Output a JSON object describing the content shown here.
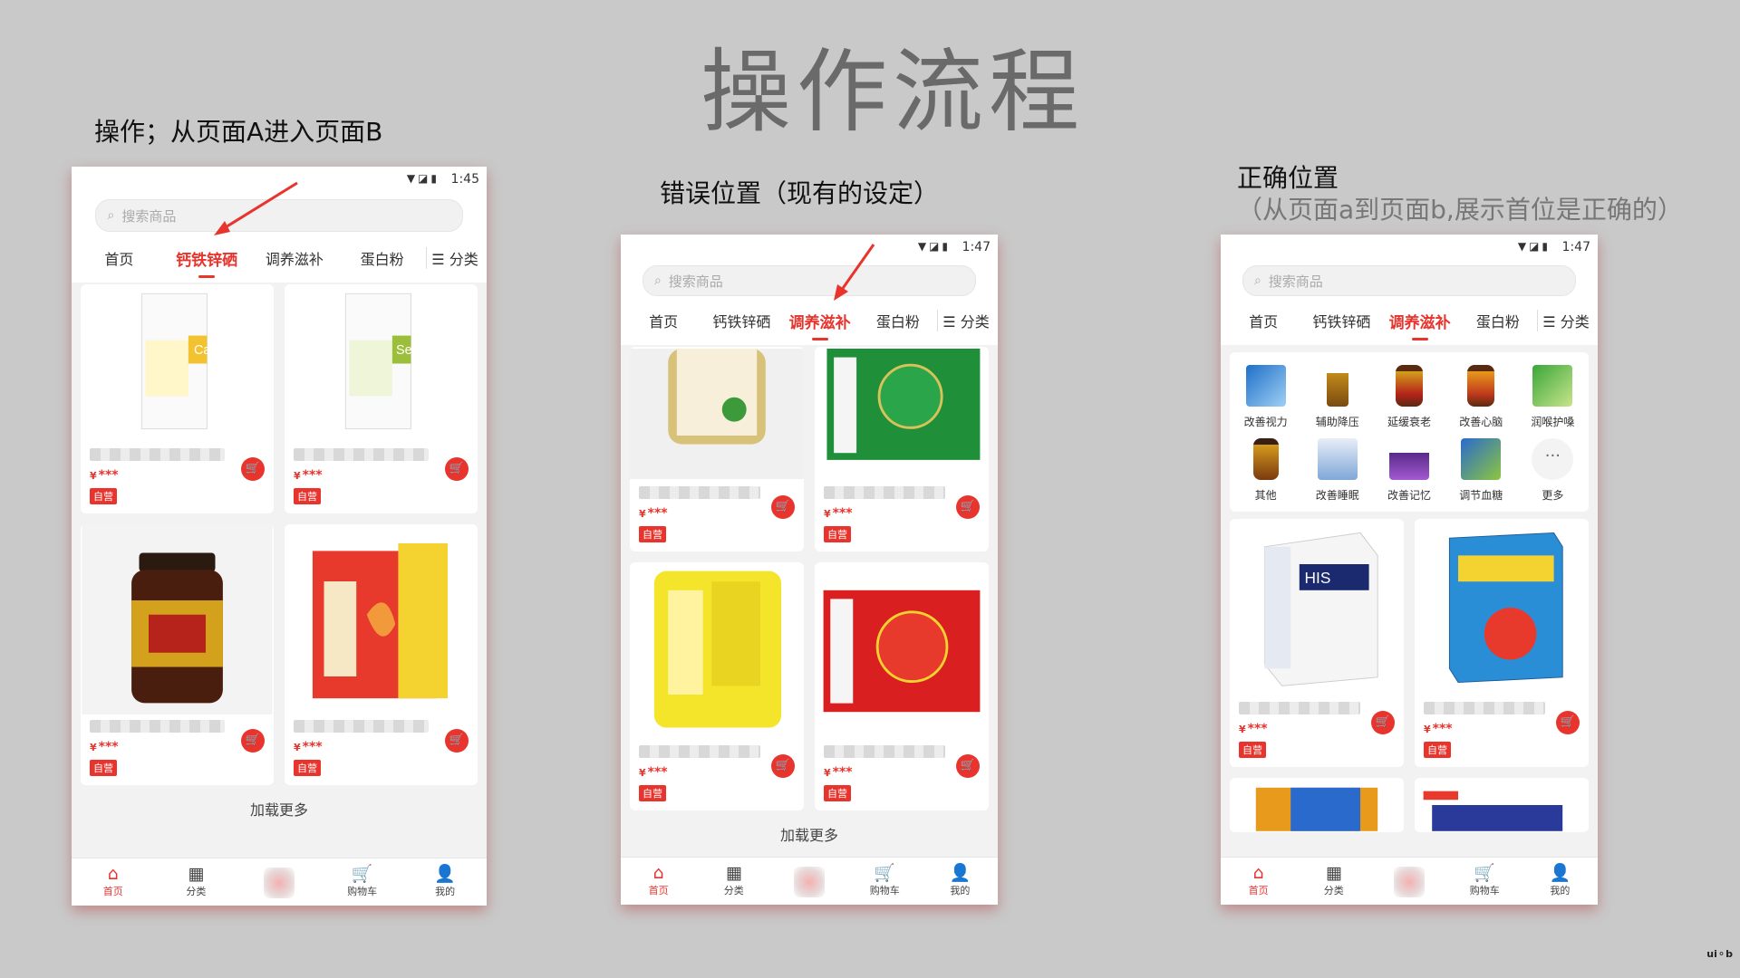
{
  "title": "操作流程",
  "labels": {
    "op": "操作；从页面A进入页面B",
    "wrong": "错误位置（现有的设定）",
    "correct": "正确位置",
    "correct_sub": "（从页面a到页面b,展示首位是正确的）"
  },
  "common": {
    "search_placeholder": "搜索商品",
    "tabs": [
      "首页",
      "钙铁锌硒",
      "调养滋补",
      "蛋白粉"
    ],
    "category_tab": "分类",
    "price": "***",
    "currency": "¥",
    "badge": "自营",
    "load_more": "加载更多",
    "nav": [
      "首页",
      "分类",
      "购物车",
      "我的"
    ],
    "colors": {
      "accent": "#e8342d",
      "background": "#c9c9c9"
    }
  },
  "phones": [
    {
      "time": "1:45",
      "active_tab": 1
    },
    {
      "time": "1:47",
      "active_tab": 2
    },
    {
      "time": "1:47",
      "active_tab": 2
    }
  ],
  "categories": [
    "改善视力",
    "辅助降压",
    "延缓衰老",
    "改善心脑",
    "润喉护嗓",
    "其他",
    "改善睡眠",
    "改善记忆",
    "调节血糖",
    "更多"
  ],
  "watermark": "ui⚬b"
}
